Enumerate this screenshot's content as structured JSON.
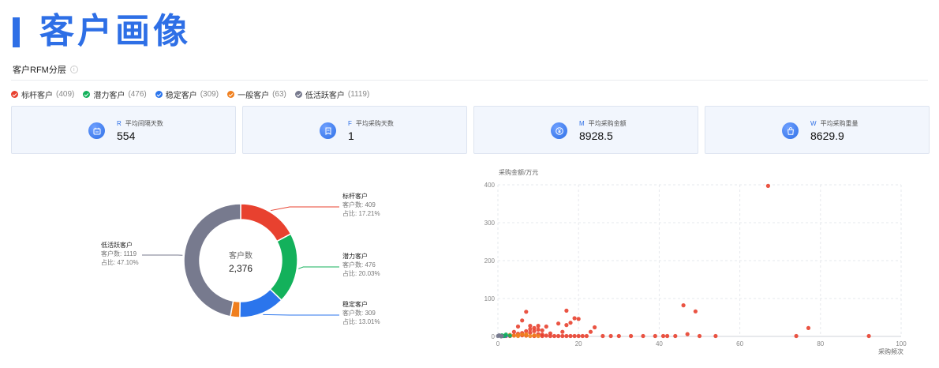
{
  "page": {
    "title": "客户画像"
  },
  "section": {
    "title": "客户RFM分层",
    "info_glyph": "i"
  },
  "legend": [
    {
      "label": "标杆客户",
      "count": "(409)",
      "color": "#e8412f"
    },
    {
      "label": "潜力客户",
      "count": "(476)",
      "color": "#13b15b"
    },
    {
      "label": "稳定客户",
      "count": "(309)",
      "color": "#2b75ec"
    },
    {
      "label": "一般客户",
      "count": "(63)",
      "color": "#f07f1e"
    },
    {
      "label": "低活跃客户",
      "count": "(1119)",
      "color": "#777a8e"
    }
  ],
  "metrics": [
    {
      "letter": "R",
      "label": "平均间隔天数",
      "value": "554",
      "icon": "calendar-icon"
    },
    {
      "letter": "F",
      "label": "平均采购天数",
      "value": "1",
      "icon": "receipt-icon"
    },
    {
      "letter": "M",
      "label": "平均采购金额",
      "value": "8928.5",
      "icon": "yen-coin-icon"
    },
    {
      "letter": "W",
      "label": "平均采购重量",
      "value": "8629.9",
      "icon": "shopping-bag-icon"
    }
  ],
  "chart_data": [
    {
      "type": "pie",
      "variant": "donut",
      "center_label": "客户数",
      "center_value": "2,376",
      "count_prefix": "客户数: ",
      "share_prefix": "占比: ",
      "slices": [
        {
          "name": "标杆客户",
          "value": 409,
          "percent": "17.21%",
          "color": "#e8412f"
        },
        {
          "name": "潜力客户",
          "value": 476,
          "percent": "20.03%",
          "color": "#13b15b"
        },
        {
          "name": "稳定客户",
          "value": 309,
          "percent": "13.01%",
          "color": "#2b75ec"
        },
        {
          "name": "一般客户",
          "value": 63,
          "percent": "2.65%",
          "color": "#f07f1e"
        },
        {
          "name": "低活跃客户",
          "value": 1119,
          "percent": "47.10%",
          "color": "#777a8e"
        }
      ],
      "labeled_slices": [
        "标杆客户",
        "潜力客户",
        "稳定客户",
        "低活跃客户"
      ]
    },
    {
      "type": "scatter",
      "ylabel": "采购金额/万元",
      "xlabel": "采购频次",
      "xlim": [
        0,
        100
      ],
      "ylim": [
        0,
        400
      ],
      "xticks": [
        0,
        20,
        40,
        60,
        80,
        100
      ],
      "yticks": [
        0,
        100,
        200,
        300,
        400
      ],
      "grid": true,
      "series": [
        {
          "color": "#e8412f",
          "points": [
            [
              67,
              397
            ],
            [
              46,
              82
            ],
            [
              49,
              66
            ],
            [
              77,
              22
            ],
            [
              92,
              1
            ],
            [
              74,
              1
            ],
            [
              17,
              68
            ],
            [
              7,
              65
            ],
            [
              19,
              48
            ],
            [
              20,
              46
            ],
            [
              18,
              36
            ],
            [
              17,
              30
            ],
            [
              15,
              34
            ],
            [
              24,
              24
            ],
            [
              23,
              12
            ],
            [
              26,
              1
            ],
            [
              28,
              1
            ],
            [
              30,
              1
            ],
            [
              33,
              1
            ],
            [
              36,
              1
            ],
            [
              39,
              1
            ],
            [
              41,
              1
            ],
            [
              42,
              1
            ],
            [
              44,
              1
            ],
            [
              47,
              6
            ],
            [
              50,
              1
            ],
            [
              54,
              1
            ],
            [
              16,
              12
            ],
            [
              13,
              8
            ],
            [
              21,
              1
            ],
            [
              6,
              42
            ],
            [
              5,
              26
            ],
            [
              8,
              28
            ],
            [
              9,
              22
            ],
            [
              10,
              28
            ],
            [
              11,
              16
            ],
            [
              12,
              26
            ],
            [
              9,
              14
            ],
            [
              8,
              10
            ],
            [
              10,
              6
            ],
            [
              11,
              5
            ],
            [
              12,
              2
            ],
            [
              13,
              1
            ],
            [
              14,
              1
            ],
            [
              15,
              1
            ],
            [
              16,
              1
            ],
            [
              17,
              1
            ],
            [
              18,
              1
            ],
            [
              19,
              1
            ],
            [
              20,
              1
            ],
            [
              22,
              1
            ],
            [
              7,
              14
            ],
            [
              6,
              9
            ],
            [
              5,
              7
            ],
            [
              4,
              3
            ],
            [
              6,
              3
            ],
            [
              7,
              2
            ],
            [
              9,
              1
            ],
            [
              11,
              1
            ],
            [
              8,
              19
            ],
            [
              10,
              18
            ],
            [
              4,
              12
            ],
            [
              3,
              1
            ],
            [
              2,
              1
            ]
          ]
        },
        {
          "color": "#f07f1e",
          "points": [
            [
              3,
              4
            ],
            [
              4,
              2
            ],
            [
              5,
              1
            ],
            [
              6,
              5
            ],
            [
              7,
              3
            ],
            [
              8,
              1
            ],
            [
              9,
              3
            ],
            [
              10,
              1
            ],
            [
              7,
              6
            ],
            [
              5,
              4
            ]
          ]
        },
        {
          "color": "#2b75ec",
          "points": [
            [
              1,
              1
            ],
            [
              2,
              2
            ],
            [
              1.5,
              1
            ]
          ]
        },
        {
          "color": "#13b15b",
          "points": [
            [
              1,
              3
            ],
            [
              2,
              5
            ],
            [
              3,
              2
            ],
            [
              1.5,
              1
            ]
          ]
        },
        {
          "color": "#777a8e",
          "points": [
            [
              0,
              1
            ],
            [
              0.5,
              2
            ],
            [
              1,
              1
            ],
            [
              0.3,
              3
            ],
            [
              0.8,
              0
            ]
          ]
        }
      ]
    }
  ]
}
